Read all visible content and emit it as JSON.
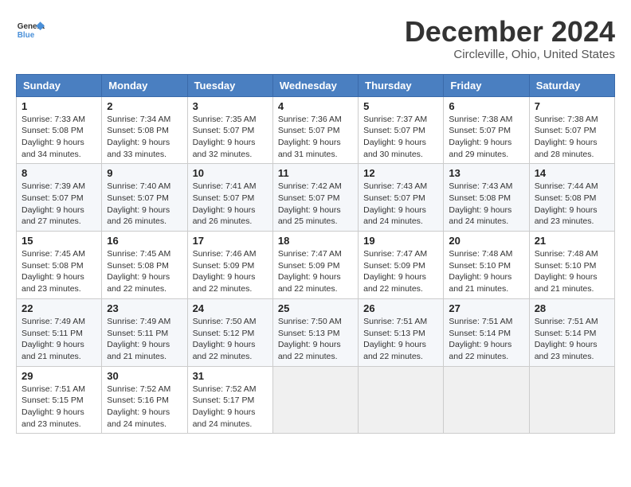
{
  "header": {
    "logo_general": "General",
    "logo_blue": "Blue",
    "title": "December 2024",
    "subtitle": "Circleville, Ohio, United States"
  },
  "calendar": {
    "headers": [
      "Sunday",
      "Monday",
      "Tuesday",
      "Wednesday",
      "Thursday",
      "Friday",
      "Saturday"
    ],
    "weeks": [
      [
        null,
        {
          "day": "2",
          "sunrise": "7:34 AM",
          "sunset": "5:08 PM",
          "daylight": "9 hours and 33 minutes."
        },
        {
          "day": "3",
          "sunrise": "7:35 AM",
          "sunset": "5:07 PM",
          "daylight": "9 hours and 32 minutes."
        },
        {
          "day": "4",
          "sunrise": "7:36 AM",
          "sunset": "5:07 PM",
          "daylight": "9 hours and 31 minutes."
        },
        {
          "day": "5",
          "sunrise": "7:37 AM",
          "sunset": "5:07 PM",
          "daylight": "9 hours and 30 minutes."
        },
        {
          "day": "6",
          "sunrise": "7:38 AM",
          "sunset": "5:07 PM",
          "daylight": "9 hours and 29 minutes."
        },
        {
          "day": "7",
          "sunrise": "7:38 AM",
          "sunset": "5:07 PM",
          "daylight": "9 hours and 28 minutes."
        }
      ],
      [
        {
          "day": "1",
          "sunrise": "7:33 AM",
          "sunset": "5:08 PM",
          "daylight": "9 hours and 34 minutes."
        },
        {
          "day": "9",
          "sunrise": "7:40 AM",
          "sunset": "5:07 PM",
          "daylight": "9 hours and 26 minutes."
        },
        {
          "day": "10",
          "sunrise": "7:41 AM",
          "sunset": "5:07 PM",
          "daylight": "9 hours and 26 minutes."
        },
        {
          "day": "11",
          "sunrise": "7:42 AM",
          "sunset": "5:07 PM",
          "daylight": "9 hours and 25 minutes."
        },
        {
          "day": "12",
          "sunrise": "7:43 AM",
          "sunset": "5:07 PM",
          "daylight": "9 hours and 24 minutes."
        },
        {
          "day": "13",
          "sunrise": "7:43 AM",
          "sunset": "5:08 PM",
          "daylight": "9 hours and 24 minutes."
        },
        {
          "day": "14",
          "sunrise": "7:44 AM",
          "sunset": "5:08 PM",
          "daylight": "9 hours and 23 minutes."
        }
      ],
      [
        {
          "day": "8",
          "sunrise": "7:39 AM",
          "sunset": "5:07 PM",
          "daylight": "9 hours and 27 minutes."
        },
        {
          "day": "16",
          "sunrise": "7:45 AM",
          "sunset": "5:08 PM",
          "daylight": "9 hours and 22 minutes."
        },
        {
          "day": "17",
          "sunrise": "7:46 AM",
          "sunset": "5:09 PM",
          "daylight": "9 hours and 22 minutes."
        },
        {
          "day": "18",
          "sunrise": "7:47 AM",
          "sunset": "5:09 PM",
          "daylight": "9 hours and 22 minutes."
        },
        {
          "day": "19",
          "sunrise": "7:47 AM",
          "sunset": "5:09 PM",
          "daylight": "9 hours and 22 minutes."
        },
        {
          "day": "20",
          "sunrise": "7:48 AM",
          "sunset": "5:10 PM",
          "daylight": "9 hours and 21 minutes."
        },
        {
          "day": "21",
          "sunrise": "7:48 AM",
          "sunset": "5:10 PM",
          "daylight": "9 hours and 21 minutes."
        }
      ],
      [
        {
          "day": "15",
          "sunrise": "7:45 AM",
          "sunset": "5:08 PM",
          "daylight": "9 hours and 23 minutes."
        },
        {
          "day": "23",
          "sunrise": "7:49 AM",
          "sunset": "5:11 PM",
          "daylight": "9 hours and 21 minutes."
        },
        {
          "day": "24",
          "sunrise": "7:50 AM",
          "sunset": "5:12 PM",
          "daylight": "9 hours and 22 minutes."
        },
        {
          "day": "25",
          "sunrise": "7:50 AM",
          "sunset": "5:13 PM",
          "daylight": "9 hours and 22 minutes."
        },
        {
          "day": "26",
          "sunrise": "7:51 AM",
          "sunset": "5:13 PM",
          "daylight": "9 hours and 22 minutes."
        },
        {
          "day": "27",
          "sunrise": "7:51 AM",
          "sunset": "5:14 PM",
          "daylight": "9 hours and 22 minutes."
        },
        {
          "day": "28",
          "sunrise": "7:51 AM",
          "sunset": "5:14 PM",
          "daylight": "9 hours and 23 minutes."
        }
      ],
      [
        {
          "day": "22",
          "sunrise": "7:49 AM",
          "sunset": "5:11 PM",
          "daylight": "9 hours and 21 minutes."
        },
        {
          "day": "30",
          "sunrise": "7:52 AM",
          "sunset": "5:16 PM",
          "daylight": "9 hours and 24 minutes."
        },
        {
          "day": "31",
          "sunrise": "7:52 AM",
          "sunset": "5:17 PM",
          "daylight": "9 hours and 24 minutes."
        },
        null,
        null,
        null,
        null
      ],
      [
        {
          "day": "29",
          "sunrise": "7:51 AM",
          "sunset": "5:15 PM",
          "daylight": "9 hours and 23 minutes."
        },
        null,
        null,
        null,
        null,
        null,
        null
      ]
    ]
  }
}
